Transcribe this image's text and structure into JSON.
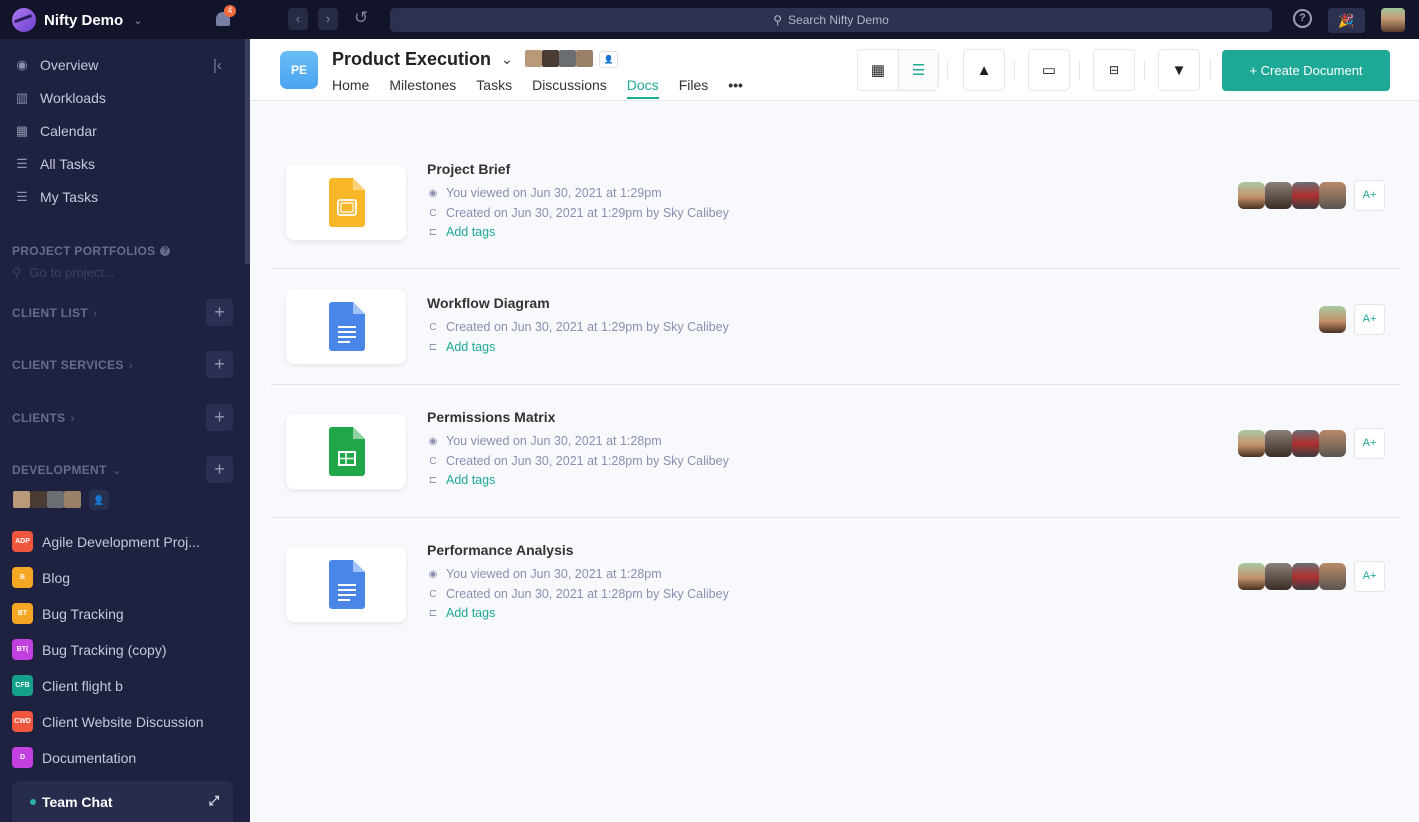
{
  "topbar": {
    "workspace": "Nifty Demo",
    "notification_count": "4",
    "back": "‹",
    "forward": "›",
    "history_icon": "↺",
    "search_placeholder": "Search Nifty Demo",
    "help": "?",
    "party": "🎉"
  },
  "sidebar": {
    "nav": [
      {
        "label": "Overview",
        "icon": "compass-icon",
        "glyph": "◉"
      },
      {
        "label": "Workloads",
        "icon": "chart-icon",
        "glyph": "▥"
      },
      {
        "label": "Calendar",
        "icon": "calendar-icon",
        "glyph": "▦"
      },
      {
        "label": "All Tasks",
        "icon": "list-icon",
        "glyph": "☰"
      },
      {
        "label": "My Tasks",
        "icon": "checklist-icon",
        "glyph": "☰"
      }
    ],
    "collapse": "|‹",
    "portfolios_heading": "PROJECT PORTFOLIOS",
    "goto_placeholder": "Go to project...",
    "portfolios": [
      {
        "label": "CLIENT LIST",
        "chev": "›"
      },
      {
        "label": "CLIENT SERVICES",
        "chev": "›"
      },
      {
        "label": "CLIENTS",
        "chev": "›"
      },
      {
        "label": "DEVELOPMENT",
        "chev": "⌄"
      }
    ],
    "add": "+",
    "projects": [
      {
        "badge": "ADP",
        "label": "Agile Development Proj...",
        "color": "#f0553e"
      },
      {
        "badge": "B",
        "label": "Blog",
        "color": "#f5a623"
      },
      {
        "badge": "BT",
        "label": "Bug Tracking",
        "color": "#f5a623"
      },
      {
        "badge": "BT(",
        "label": "Bug Tracking (copy)",
        "color": "#c240e0"
      },
      {
        "badge": "CFB",
        "label": "Client flight b",
        "color": "#14a08a"
      },
      {
        "badge": "CWD",
        "label": "Client Website Discussion",
        "color": "#f0553e"
      },
      {
        "badge": "D",
        "label": "Documentation",
        "color": "#c240e0"
      }
    ],
    "team_chat": "Team Chat",
    "expand": "⤢"
  },
  "header": {
    "badge": "PE",
    "title": "Product Execution",
    "chev": "⌄",
    "add_member": "👤+",
    "tabs": [
      "Home",
      "Milestones",
      "Tasks",
      "Discussions",
      "Docs",
      "Files",
      "•••"
    ],
    "active_tab": "Docs",
    "create_label": "+ Create Document",
    "accent": "#1ea896"
  },
  "docs": [
    {
      "title": "Project Brief",
      "type": "slides",
      "viewed": "You viewed on Jun 30, 2021 at 1:29pm",
      "created": "Created on Jun 30, 2021 at 1:29pm by Sky Calibey",
      "tags": "Add tags",
      "members": 4
    },
    {
      "title": "Workflow Diagram",
      "type": "doc",
      "viewed": null,
      "created": "Created on Jun 30, 2021 at 1:29pm by Sky Calibey",
      "tags": "Add tags",
      "members": 1
    },
    {
      "title": "Permissions Matrix",
      "type": "sheet",
      "viewed": "You viewed on Jun 30, 2021 at 1:28pm",
      "created": "Created on Jun 30, 2021 at 1:28pm by Sky Calibey",
      "tags": "Add tags",
      "members": 4
    },
    {
      "title": "Performance Analysis",
      "type": "doc",
      "viewed": "You viewed on Jun 30, 2021 at 1:28pm",
      "created": "Created on Jun 30, 2021 at 1:28pm by Sky Calibey",
      "tags": "Add tags",
      "members": 4
    }
  ],
  "icons": {
    "eye": "◉",
    "refresh": "C",
    "tag": "⊏",
    "add_user": "A+"
  },
  "avatar_colors": [
    "#a8c9a0",
    "#4a3b33",
    "#5a5f63",
    "#8a7060"
  ]
}
